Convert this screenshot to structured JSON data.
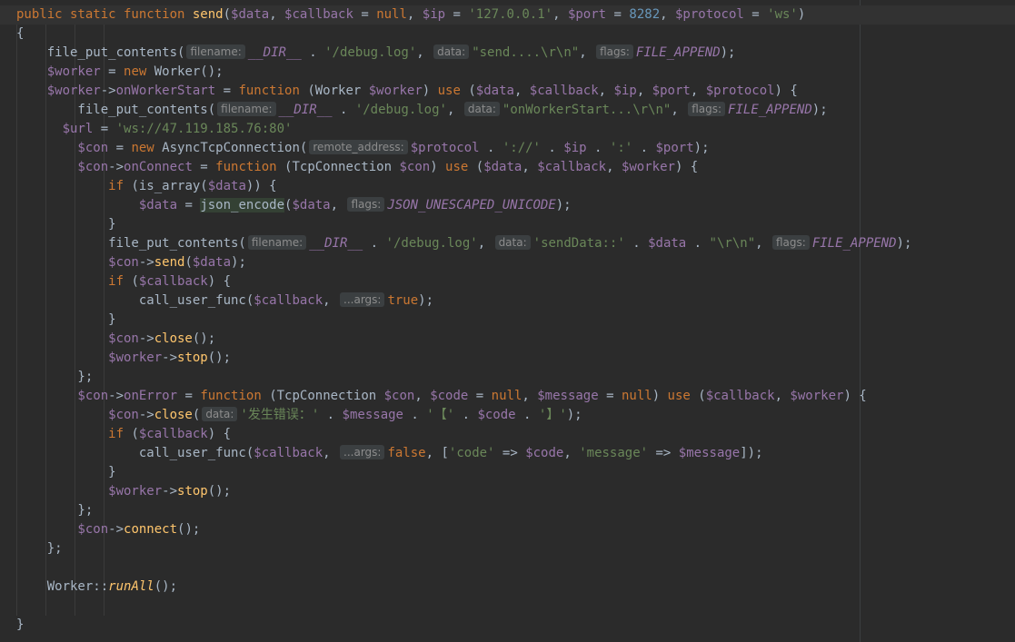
{
  "editor": {
    "lines": [
      [
        {
          "c": "kw",
          "t": "public static function "
        },
        {
          "c": "fn",
          "t": "send"
        },
        {
          "c": "plain",
          "t": "("
        },
        {
          "c": "var",
          "t": "$data"
        },
        {
          "c": "plain",
          "t": ", "
        },
        {
          "c": "var",
          "t": "$callback"
        },
        {
          "c": "plain",
          "t": " = "
        },
        {
          "c": "kw",
          "t": "null"
        },
        {
          "c": "plain",
          "t": ", "
        },
        {
          "c": "var",
          "t": "$ip"
        },
        {
          "c": "plain",
          "t": " = "
        },
        {
          "c": "str",
          "t": "'127.0.0.1'"
        },
        {
          "c": "plain",
          "t": ", "
        },
        {
          "c": "var",
          "t": "$port"
        },
        {
          "c": "plain",
          "t": " = "
        },
        {
          "c": "num",
          "t": "8282"
        },
        {
          "c": "plain",
          "t": ", "
        },
        {
          "c": "var",
          "t": "$protocol"
        },
        {
          "c": "plain",
          "t": " = "
        },
        {
          "c": "str",
          "t": "'ws'"
        },
        {
          "c": "plain",
          "t": ")"
        }
      ],
      [
        {
          "c": "plain",
          "t": "{"
        }
      ],
      [
        {
          "c": "plain",
          "t": "    file_put_contents("
        },
        {
          "c": "hint",
          "t": "filename:"
        },
        {
          "c": "const",
          "t": "__DIR__"
        },
        {
          "c": "plain",
          "t": " . "
        },
        {
          "c": "str",
          "t": "'/debug.log'"
        },
        {
          "c": "plain",
          "t": ", "
        },
        {
          "c": "hint",
          "t": "data:"
        },
        {
          "c": "str",
          "t": "\"send....\\r\\n\""
        },
        {
          "c": "plain",
          "t": ", "
        },
        {
          "c": "hint",
          "t": "flags:"
        },
        {
          "c": "const",
          "t": "FILE_APPEND"
        },
        {
          "c": "plain",
          "t": ");"
        }
      ],
      [
        {
          "c": "var",
          "t": "    $worker"
        },
        {
          "c": "plain",
          "t": " = "
        },
        {
          "c": "kw",
          "t": "new "
        },
        {
          "c": "plain",
          "t": "Worker();"
        }
      ],
      [
        {
          "c": "var",
          "t": "    $worker"
        },
        {
          "c": "plain",
          "t": "->"
        },
        {
          "c": "var",
          "t": "onWorkerStart"
        },
        {
          "c": "plain",
          "t": " = "
        },
        {
          "c": "kw",
          "t": "function "
        },
        {
          "c": "plain",
          "t": "(Worker "
        },
        {
          "c": "var",
          "t": "$worker"
        },
        {
          "c": "plain",
          "t": ") "
        },
        {
          "c": "kw",
          "t": "use "
        },
        {
          "c": "plain",
          "t": "("
        },
        {
          "c": "var",
          "t": "$data"
        },
        {
          "c": "plain",
          "t": ", "
        },
        {
          "c": "var",
          "t": "$callback"
        },
        {
          "c": "plain",
          "t": ", "
        },
        {
          "c": "var",
          "t": "$ip"
        },
        {
          "c": "plain",
          "t": ", "
        },
        {
          "c": "var",
          "t": "$port"
        },
        {
          "c": "plain",
          "t": ", "
        },
        {
          "c": "var",
          "t": "$protocol"
        },
        {
          "c": "plain",
          "t": ") {"
        }
      ],
      [
        {
          "c": "plain",
          "t": "        file_put_contents("
        },
        {
          "c": "hint",
          "t": "filename:"
        },
        {
          "c": "const",
          "t": "__DIR__"
        },
        {
          "c": "plain",
          "t": " . "
        },
        {
          "c": "str",
          "t": "'/debug.log'"
        },
        {
          "c": "plain",
          "t": ", "
        },
        {
          "c": "hint",
          "t": "data:"
        },
        {
          "c": "str",
          "t": "\"onWorkerStart...\\r\\n\""
        },
        {
          "c": "plain",
          "t": ", "
        },
        {
          "c": "hint",
          "t": "flags:"
        },
        {
          "c": "const",
          "t": "FILE_APPEND"
        },
        {
          "c": "plain",
          "t": ");"
        }
      ],
      [
        {
          "c": "var",
          "t": "      $url"
        },
        {
          "c": "plain",
          "t": " = "
        },
        {
          "c": "str",
          "t": "'ws://47.119.185.76:80'"
        }
      ],
      [
        {
          "c": "var",
          "t": "        $con"
        },
        {
          "c": "plain",
          "t": " = "
        },
        {
          "c": "kw",
          "t": "new "
        },
        {
          "c": "plain",
          "t": "AsyncTcpConnection("
        },
        {
          "c": "hint",
          "t": "remote_address:"
        },
        {
          "c": "var",
          "t": "$protocol"
        },
        {
          "c": "plain",
          "t": " . "
        },
        {
          "c": "str",
          "t": "'://'"
        },
        {
          "c": "plain",
          "t": " . "
        },
        {
          "c": "var",
          "t": "$ip"
        },
        {
          "c": "plain",
          "t": " . "
        },
        {
          "c": "str",
          "t": "':'"
        },
        {
          "c": "plain",
          "t": " . "
        },
        {
          "c": "var",
          "t": "$port"
        },
        {
          "c": "plain",
          "t": ");"
        }
      ],
      [
        {
          "c": "var",
          "t": "        $con"
        },
        {
          "c": "plain",
          "t": "->"
        },
        {
          "c": "var",
          "t": "onConnect"
        },
        {
          "c": "plain",
          "t": " = "
        },
        {
          "c": "kw",
          "t": "function "
        },
        {
          "c": "plain",
          "t": "(TcpConnection "
        },
        {
          "c": "var",
          "t": "$con"
        },
        {
          "c": "plain",
          "t": ") "
        },
        {
          "c": "kw",
          "t": "use "
        },
        {
          "c": "plain",
          "t": "("
        },
        {
          "c": "var",
          "t": "$data"
        },
        {
          "c": "plain",
          "t": ", "
        },
        {
          "c": "var",
          "t": "$callback"
        },
        {
          "c": "plain",
          "t": ", "
        },
        {
          "c": "var",
          "t": "$worker"
        },
        {
          "c": "plain",
          "t": ") {"
        }
      ],
      [
        {
          "c": "kw",
          "t": "            if "
        },
        {
          "c": "plain",
          "t": "(is_array("
        },
        {
          "c": "var",
          "t": "$data"
        },
        {
          "c": "plain",
          "t": ")) {"
        }
      ],
      [
        {
          "c": "var",
          "t": "                $data"
        },
        {
          "c": "plain",
          "t": " = "
        },
        {
          "c": "hl",
          "t": "json_encode"
        },
        {
          "c": "plain",
          "t": "("
        },
        {
          "c": "var",
          "t": "$data"
        },
        {
          "c": "plain",
          "t": ", "
        },
        {
          "c": "hint",
          "t": "flags:"
        },
        {
          "c": "const",
          "t": "JSON_UNESCAPED_UNICODE"
        },
        {
          "c": "plain",
          "t": ");"
        }
      ],
      [
        {
          "c": "plain",
          "t": "            }"
        }
      ],
      [
        {
          "c": "plain",
          "t": "            file_put_contents("
        },
        {
          "c": "hint",
          "t": "filename:"
        },
        {
          "c": "const",
          "t": "__DIR__"
        },
        {
          "c": "plain",
          "t": " . "
        },
        {
          "c": "str",
          "t": "'/debug.log'"
        },
        {
          "c": "plain",
          "t": ", "
        },
        {
          "c": "hint",
          "t": "data:"
        },
        {
          "c": "str",
          "t": "'sendData::'"
        },
        {
          "c": "plain",
          "t": " . "
        },
        {
          "c": "var",
          "t": "$data"
        },
        {
          "c": "plain",
          "t": " . "
        },
        {
          "c": "str",
          "t": "\"\\r\\n\""
        },
        {
          "c": "plain",
          "t": ", "
        },
        {
          "c": "hint",
          "t": "flags:"
        },
        {
          "c": "const",
          "t": "FILE_APPEND"
        },
        {
          "c": "plain",
          "t": ");"
        }
      ],
      [
        {
          "c": "var",
          "t": "            $con"
        },
        {
          "c": "plain",
          "t": "->"
        },
        {
          "c": "fn",
          "t": "send"
        },
        {
          "c": "plain",
          "t": "("
        },
        {
          "c": "var",
          "t": "$data"
        },
        {
          "c": "plain",
          "t": ");"
        }
      ],
      [
        {
          "c": "kw",
          "t": "            if "
        },
        {
          "c": "plain",
          "t": "("
        },
        {
          "c": "var",
          "t": "$callback"
        },
        {
          "c": "plain",
          "t": ") {"
        }
      ],
      [
        {
          "c": "plain",
          "t": "                call_user_func("
        },
        {
          "c": "var",
          "t": "$callback"
        },
        {
          "c": "plain",
          "t": ", "
        },
        {
          "c": "hint",
          "t": "...args:"
        },
        {
          "c": "kw",
          "t": "true"
        },
        {
          "c": "plain",
          "t": ");"
        }
      ],
      [
        {
          "c": "plain",
          "t": "            }"
        }
      ],
      [
        {
          "c": "var",
          "t": "            $con"
        },
        {
          "c": "plain",
          "t": "->"
        },
        {
          "c": "fn",
          "t": "close"
        },
        {
          "c": "plain",
          "t": "();"
        }
      ],
      [
        {
          "c": "var",
          "t": "            $worker"
        },
        {
          "c": "plain",
          "t": "->"
        },
        {
          "c": "fn",
          "t": "stop"
        },
        {
          "c": "plain",
          "t": "();"
        }
      ],
      [
        {
          "c": "plain",
          "t": "        };"
        }
      ],
      [
        {
          "c": "var",
          "t": "        $con"
        },
        {
          "c": "plain",
          "t": "->"
        },
        {
          "c": "var",
          "t": "onError"
        },
        {
          "c": "plain",
          "t": " = "
        },
        {
          "c": "kw",
          "t": "function "
        },
        {
          "c": "plain",
          "t": "(TcpConnection "
        },
        {
          "c": "var",
          "t": "$con"
        },
        {
          "c": "plain",
          "t": ", "
        },
        {
          "c": "var",
          "t": "$code"
        },
        {
          "c": "plain",
          "t": " = "
        },
        {
          "c": "kw",
          "t": "null"
        },
        {
          "c": "plain",
          "t": ", "
        },
        {
          "c": "var",
          "t": "$message"
        },
        {
          "c": "plain",
          "t": " = "
        },
        {
          "c": "kw",
          "t": "null"
        },
        {
          "c": "plain",
          "t": ") "
        },
        {
          "c": "kw",
          "t": "use "
        },
        {
          "c": "plain",
          "t": "("
        },
        {
          "c": "var",
          "t": "$callback"
        },
        {
          "c": "plain",
          "t": ", "
        },
        {
          "c": "var",
          "t": "$worker"
        },
        {
          "c": "plain",
          "t": ") {"
        }
      ],
      [
        {
          "c": "var",
          "t": "            $con"
        },
        {
          "c": "plain",
          "t": "->"
        },
        {
          "c": "fn",
          "t": "close"
        },
        {
          "c": "plain",
          "t": "("
        },
        {
          "c": "hint",
          "t": "data:"
        },
        {
          "c": "str",
          "t": "'发生错误：'"
        },
        {
          "c": "plain",
          "t": " . "
        },
        {
          "c": "var",
          "t": "$message"
        },
        {
          "c": "plain",
          "t": " . "
        },
        {
          "c": "str",
          "t": "'【'"
        },
        {
          "c": "plain",
          "t": " . "
        },
        {
          "c": "var",
          "t": "$code"
        },
        {
          "c": "plain",
          "t": " . "
        },
        {
          "c": "str",
          "t": "'】'"
        },
        {
          "c": "plain",
          "t": ");"
        }
      ],
      [
        {
          "c": "kw",
          "t": "            if "
        },
        {
          "c": "plain",
          "t": "("
        },
        {
          "c": "var",
          "t": "$callback"
        },
        {
          "c": "plain",
          "t": ") {"
        }
      ],
      [
        {
          "c": "plain",
          "t": "                call_user_func("
        },
        {
          "c": "var",
          "t": "$callback"
        },
        {
          "c": "plain",
          "t": ", "
        },
        {
          "c": "hint",
          "t": "...args:"
        },
        {
          "c": "kw",
          "t": "false"
        },
        {
          "c": "plain",
          "t": ", ["
        },
        {
          "c": "str",
          "t": "'code'"
        },
        {
          "c": "plain",
          "t": " => "
        },
        {
          "c": "var",
          "t": "$code"
        },
        {
          "c": "plain",
          "t": ", "
        },
        {
          "c": "str",
          "t": "'message'"
        },
        {
          "c": "plain",
          "t": " => "
        },
        {
          "c": "var",
          "t": "$message"
        },
        {
          "c": "plain",
          "t": "]);"
        }
      ],
      [
        {
          "c": "plain",
          "t": "            }"
        }
      ],
      [
        {
          "c": "var",
          "t": "            $worker"
        },
        {
          "c": "plain",
          "t": "->"
        },
        {
          "c": "fn",
          "t": "stop"
        },
        {
          "c": "plain",
          "t": "();"
        }
      ],
      [
        {
          "c": "plain",
          "t": "        };"
        }
      ],
      [
        {
          "c": "var",
          "t": "        $con"
        },
        {
          "c": "plain",
          "t": "->"
        },
        {
          "c": "fn",
          "t": "connect"
        },
        {
          "c": "plain",
          "t": "();"
        }
      ],
      [
        {
          "c": "plain",
          "t": "    };"
        }
      ],
      [],
      [
        {
          "c": "plain",
          "t": "    Worker::"
        },
        {
          "c": "static-call",
          "t": "runAll"
        },
        {
          "c": "plain",
          "t": "();"
        }
      ],
      [],
      [
        {
          "c": "plain",
          "t": "}"
        }
      ]
    ]
  }
}
